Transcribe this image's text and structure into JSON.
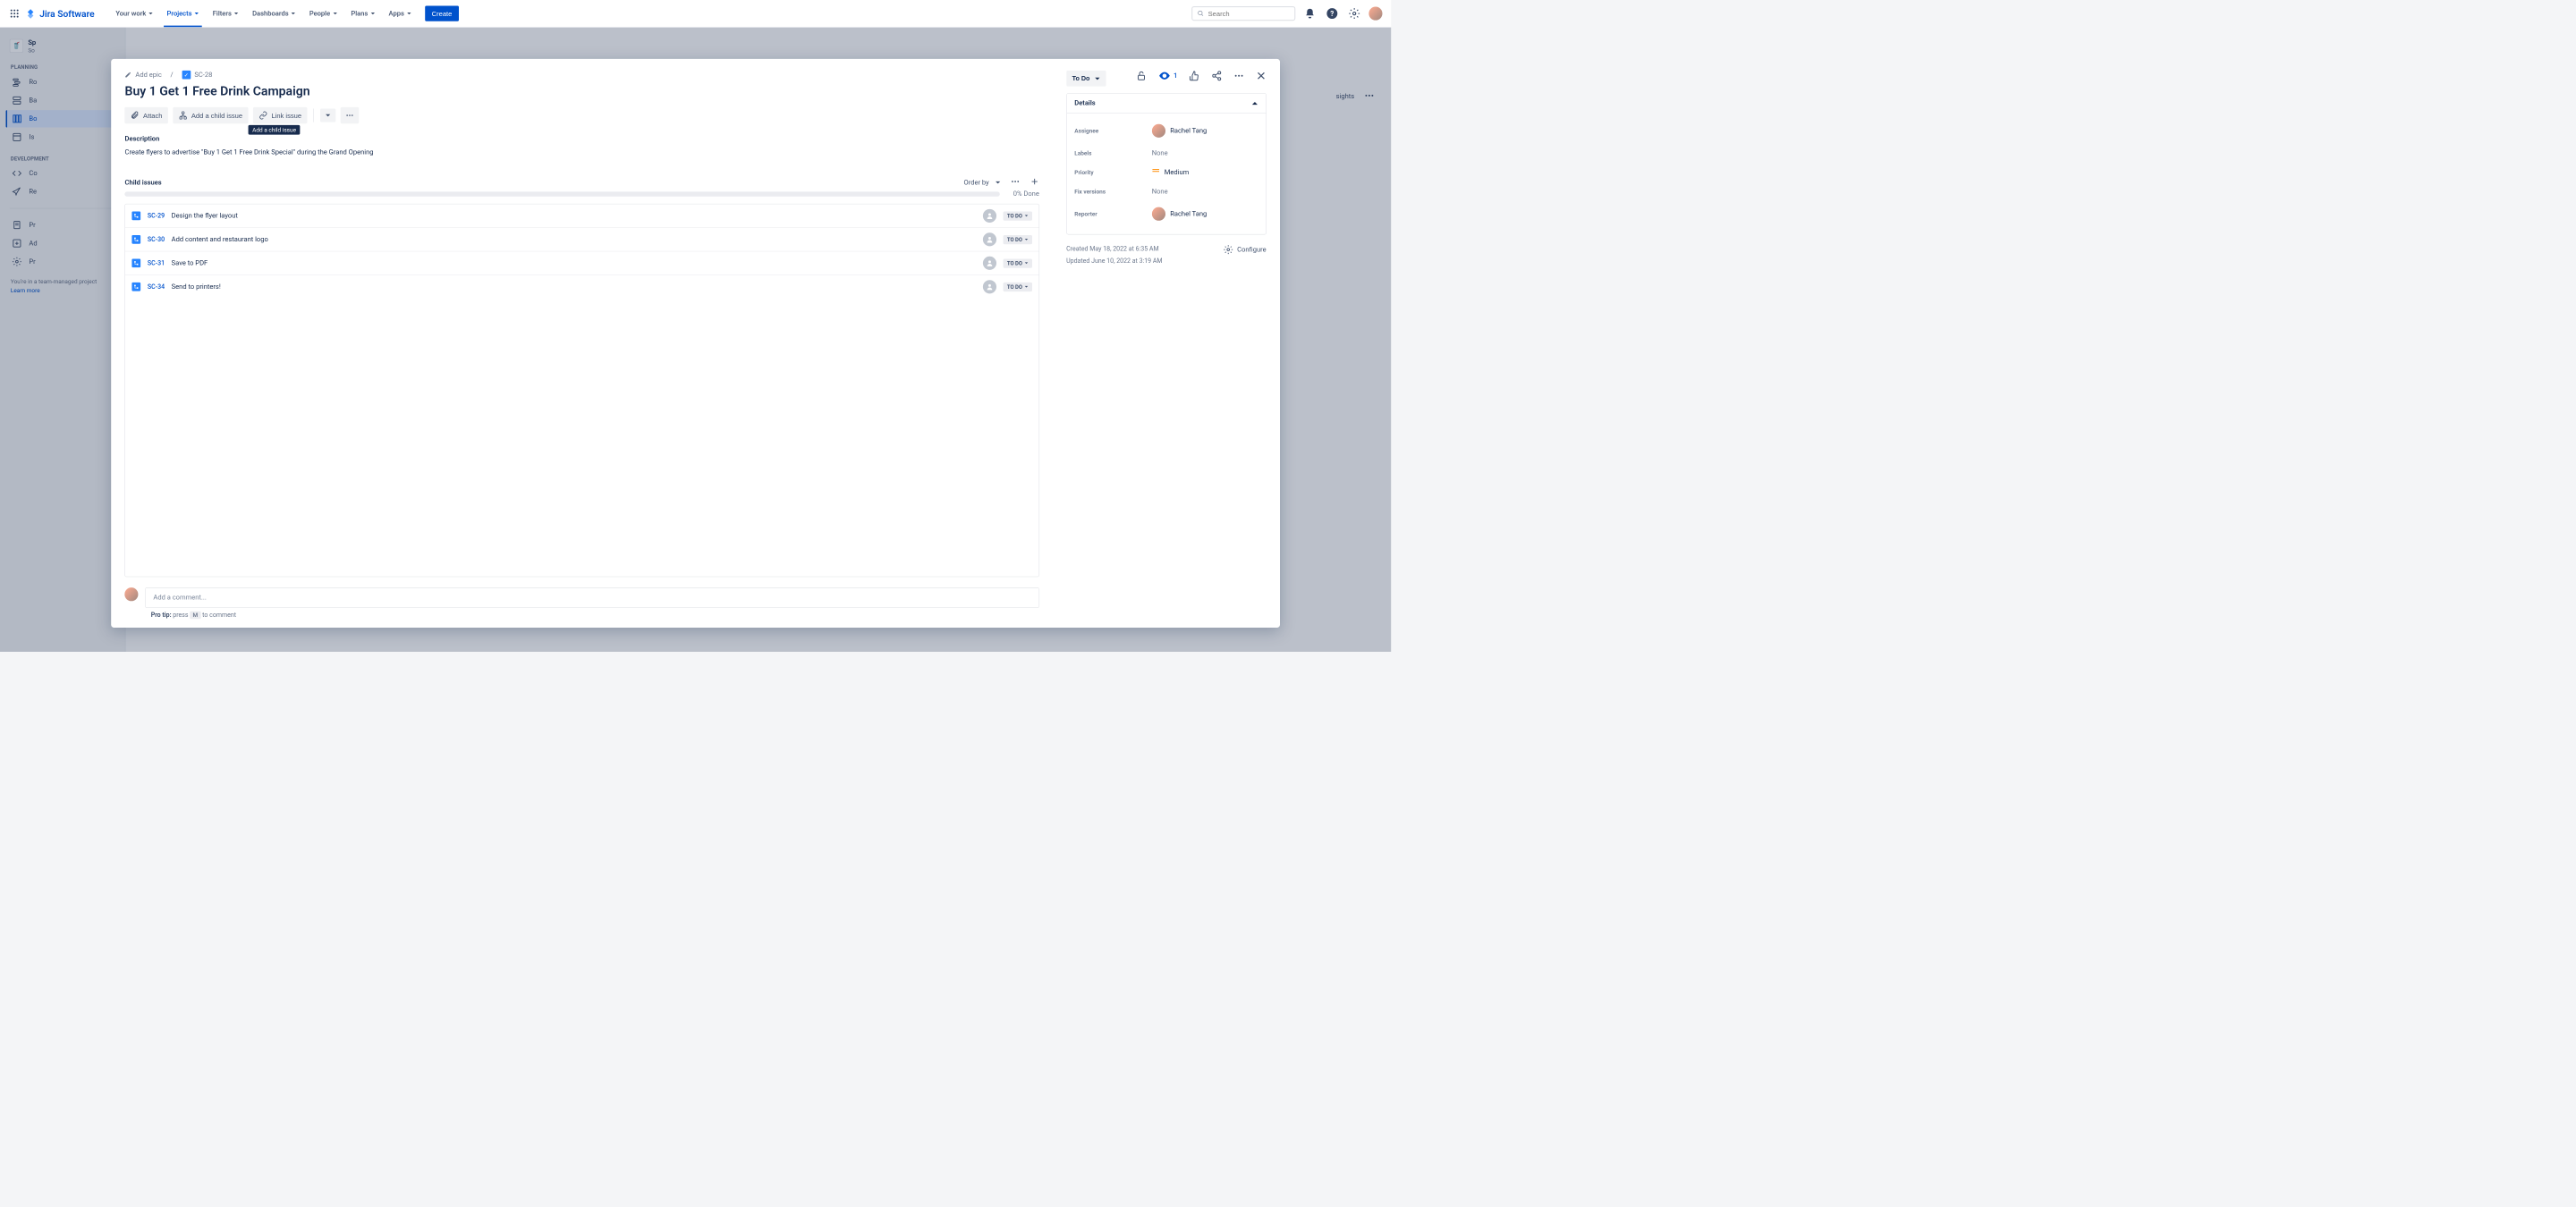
{
  "topnav": {
    "logo": "Jira Software",
    "items": [
      "Your work",
      "Projects",
      "Filters",
      "Dashboards",
      "People",
      "Plans",
      "Apps"
    ],
    "active_index": 1,
    "create": "Create",
    "search_placeholder": "Search"
  },
  "sidebar": {
    "project_name": "Sp",
    "project_type": "So",
    "sections": {
      "planning": {
        "label": "PLANNING",
        "items": [
          "Ro",
          "Ba",
          "Bo",
          "Is"
        ],
        "active_index": 2
      },
      "development": {
        "label": "DEVELOPMENT",
        "items": [
          "Co",
          "Re"
        ]
      },
      "other": {
        "items": [
          "Pr",
          "Ad",
          "Pr"
        ]
      }
    },
    "team_managed": "You're in a team-managed project",
    "learn_more": "Learn more"
  },
  "issue": {
    "breadcrumb": {
      "add_epic": "Add epic",
      "key": "SC-28"
    },
    "title": "Buy 1 Get 1 Free Drink Campaign",
    "actions": {
      "attach": "Attach",
      "add_child": "Add a child issue",
      "link": "Link issue",
      "tooltip": "Add a child issue"
    },
    "watch_count": "1",
    "description_label": "Description",
    "description": "Create flyers to advertise \"Buy 1 Get 1 Free Drink Special\" during the Grand Opening",
    "child_issues_label": "Child issues",
    "order_by": "Order by",
    "progress": "0% Done",
    "children": [
      {
        "key": "SC-29",
        "summary": "Design the flyer layout",
        "status": "TO DO"
      },
      {
        "key": "SC-30",
        "summary": "Add content and restaurant logo",
        "status": "TO DO"
      },
      {
        "key": "SC-31",
        "summary": "Save to PDF",
        "status": "TO DO"
      },
      {
        "key": "SC-34",
        "summary": "Send to printers!",
        "status": "TO DO"
      }
    ],
    "comment_placeholder": "Add a comment...",
    "protip_label": "Pro tip:",
    "protip_press": "press",
    "protip_key": "M",
    "protip_rest": "to comment"
  },
  "side": {
    "status": "To Do",
    "details_label": "Details",
    "fields": {
      "assignee": {
        "label": "Assignee",
        "value": "Rachel Tang"
      },
      "labels": {
        "label": "Labels",
        "value": "None"
      },
      "priority": {
        "label": "Priority",
        "value": "Medium"
      },
      "fix_versions": {
        "label": "Fix versions",
        "value": "None"
      },
      "reporter": {
        "label": "Reporter",
        "value": "Rachel Tang"
      }
    },
    "created": "Created May 18, 2022 at 6:35 AM",
    "updated": "Updated June 10, 2022 at 3:19 AM",
    "configure": "Configure"
  },
  "board": {
    "insights": "sights"
  }
}
